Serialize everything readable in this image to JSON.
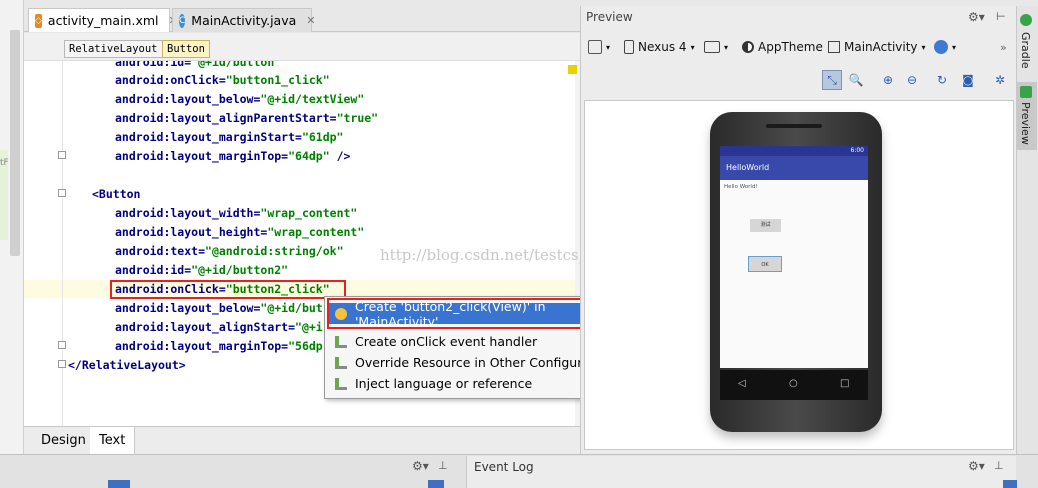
{
  "editor": {
    "tabs": [
      {
        "label": "activity_main.xml",
        "icon": "xml-file-icon"
      },
      {
        "label": "MainActivity.java",
        "icon": "java-class-icon"
      }
    ],
    "breadcrumbs": [
      "RelativeLayout",
      "Button"
    ],
    "code_lines": [
      {
        "attr": "android:id=",
        "val": "\"@+id/button\""
      },
      {
        "attr": "android:onClick=",
        "val": "\"button1_click\""
      },
      {
        "attr": "android:layout_below=",
        "val": "\"@+id/textView\""
      },
      {
        "attr": "android:layout_alignParentStart=",
        "val": "\"true\""
      },
      {
        "attr": "android:layout_marginStart=",
        "val": "\"61dp\""
      },
      {
        "attr": "android:layout_marginTop=",
        "val": "\"64dp\"",
        "tail": " />"
      },
      {
        "tag": "<Button"
      },
      {
        "attr": "android:layout_width=",
        "val": "\"wrap_content\""
      },
      {
        "attr": "android:layout_height=",
        "val": "\"wrap_content\""
      },
      {
        "attr": "android:text=",
        "val": "\"@android:string/ok\""
      },
      {
        "attr": "android:id=",
        "val": "\"@+id/button2\""
      },
      {
        "attr": "android:onClick=",
        "val": "\"button2_click\""
      },
      {
        "attr": "android:layout_below=",
        "val": "\"@+id/but"
      },
      {
        "attr": "android:layout_alignStart=",
        "val": "\"@+i"
      },
      {
        "attr": "android:layout_marginTop=",
        "val": "\"56dp"
      },
      {
        "tag": "</RelativeLayout>"
      }
    ],
    "watermark": "http://blog.csdn.net/testcs_dn",
    "mode_tabs": [
      "Design",
      "Text"
    ]
  },
  "context_menu": {
    "items": [
      {
        "label": "Create 'button2_click(View)' in 'MainActivity'",
        "icon": "lightbulb-icon"
      },
      {
        "label": "Create onClick event handler",
        "icon": "intention-icon"
      },
      {
        "label": "Override Resource in Other Configuration...",
        "icon": "intention-icon"
      },
      {
        "label": "Inject language or reference",
        "icon": "intention-icon"
      }
    ]
  },
  "preview": {
    "title": "Preview",
    "device": "Nexus 4",
    "theme": "AppTheme",
    "activity": "MainActivity",
    "phone": {
      "status_time": "6:00",
      "app_title": "HelloWorld",
      "hello_text": "Hello World!",
      "button1": "测试",
      "button2": "OK"
    }
  },
  "rail": {
    "gradle": "Gradle",
    "preview": "Preview"
  },
  "bottom": {
    "event_log": "Event Log"
  }
}
